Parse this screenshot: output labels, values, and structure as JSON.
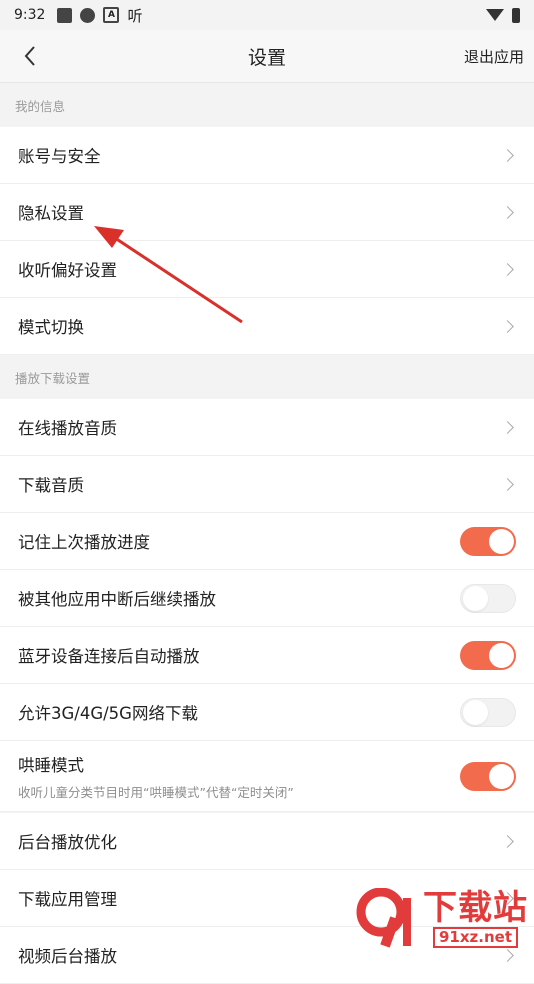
{
  "status_bar": {
    "time": "9:32",
    "app_glyph": "听"
  },
  "nav": {
    "title": "设置",
    "exit_label": "退出应用"
  },
  "sections": {
    "my_info": {
      "header": "我的信息",
      "items": [
        "账号与安全",
        "隐私设置",
        "收听偏好设置",
        "模式切换"
      ]
    },
    "playback": {
      "header": "播放下载设置",
      "items": {
        "online_quality": "在线播放音质",
        "download_quality": "下载音质",
        "remember_progress": "记住上次播放进度",
        "interrupt_continue": "被其他应用中断后继续播放",
        "bluetooth_autoplay": "蓝牙设备连接后自动播放",
        "allow_mobile_download": "允许3G/4G/5G网络下载",
        "sleep_mode": "哄睡模式",
        "sleep_mode_desc": "收听儿童分类节目时用“哄睡模式”代替“定时关闭”",
        "background_opt": "后台播放优化",
        "download_mgmt": "下载应用管理",
        "video_background": "视频后台播放"
      }
    }
  },
  "toggles": {
    "remember_progress": true,
    "interrupt_continue": false,
    "bluetooth_autoplay": true,
    "allow_mobile_download": false,
    "sleep_mode": true
  },
  "colors": {
    "accent": "#f26b4c",
    "annotation_arrow": "#d9302a",
    "watermark": "#e23b3b"
  },
  "watermark": {
    "text": "下载站",
    "url": "91xz.net"
  }
}
